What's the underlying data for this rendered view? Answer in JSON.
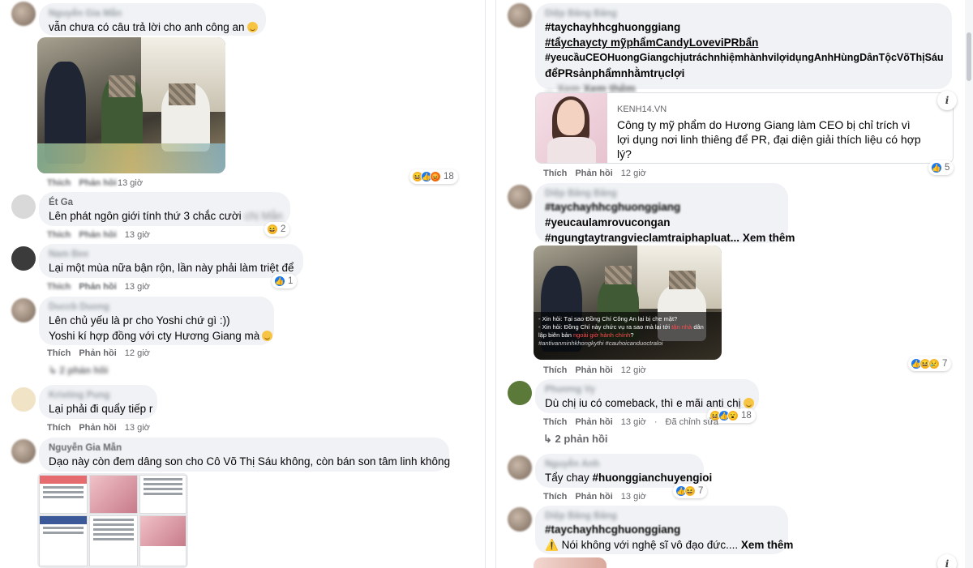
{
  "actions": {
    "like": "Thích",
    "reply": "Phản hồi",
    "edited": "Đã chỉnh sửa"
  },
  "left": {
    "c1": {
      "name": "Nguyễn Gia Mẫn",
      "text": "vẫn chưa có câu trả lời cho anh công an",
      "time": "13 giờ",
      "reactions": 18
    },
    "c2": {
      "name": "Ét Ga",
      "text_visible": "Lên phát ngôn giới tính thứ 3 chắc cười",
      "text_blurred": "chị Mẫn",
      "time": "13 giờ",
      "reactions": 2
    },
    "c3": {
      "name": "Nam Bee",
      "text": "Lại một mùa nữa bận rộn, lần này phải làm triệt để",
      "time": "13 giờ",
      "reactions": 1
    },
    "c4": {
      "name": "Duccb Duong",
      "line1": "Lên chủ yếu là pr cho Yoshi chứ gì :))",
      "line2": "Yoshi kí hợp đồng với cty Hương Giang mà",
      "time": "12 giờ",
      "replies": "2 phản hồi"
    },
    "c5": {
      "name": "Kristing Pung",
      "text": "Lại phải đi quẩy tiếp r",
      "time": "13 giờ"
    },
    "c6": {
      "name": "Nguyễn Gia Mẫn",
      "text": "Dạo này còn đem dâng son cho Cô Võ Thị Sáu không, còn bán son tâm linh không"
    }
  },
  "right": {
    "r1": {
      "name": "Diệp Băng Băng",
      "tag1": "#taychayhhcghuonggiang",
      "tag2": "#tẩychaycty mỹphẩmCandyLoveviPRbẩn",
      "tag3": "#yeucầuCEOHuongGiangchịutráchnhiệmhànhvilợidụngAnhHùngDânTộcVõThịSáu",
      "tag4": "đểPRsảnphẩmnhằmtrụclợi",
      "more": "Xem thêm",
      "link_source": "KENH14.VN",
      "link_title": "Công ty mỹ phẩm do Hương Giang làm CEO bị chỉ trích vì lợi dụng nơi linh thiêng để PR, đại diện giải thích liệu có hợp lý?",
      "time": "12 giờ",
      "reactions": 5
    },
    "r2": {
      "name": "Diệp Băng Băng",
      "tag1": "#taychayhhcghuonggiang",
      "tag2": "#yeucaulamrovucongan",
      "tag3": "#ngungtaytrangvieclamtraiphapluat...",
      "more": "Xem thêm",
      "caption1": "- Xin hỏi: Tại sao Đồng Chí Công An lại bị che mặt?",
      "caption2a": "- Xin hỏi: Đồng Chí này chức vụ ra sao mà lại tới",
      "caption2b": "tận nhà",
      "caption2c": "dân",
      "caption3a": "lập biên bản",
      "caption3b": "ngoài giờ hành chính",
      "caption3c": "?",
      "caption4": "#antivanminhkhongkythi   #cauhoicanduoctraloi",
      "time": "12 giờ",
      "reactions": 7
    },
    "r3": {
      "name": "Phương Vy",
      "text": "Dù chị iu có comeback, thì e mãi anti chị",
      "time": "13 giờ",
      "reactions": 18,
      "replies": "2 phản hồi"
    },
    "r4": {
      "name": "Nguyễn Anh",
      "text_prefix": "Tẩy chay",
      "text_tag": "#huonggianchuyengioi",
      "time": "13 giờ",
      "reactions": 7
    },
    "r5": {
      "name": "Diệp Băng Băng",
      "tag1": "#taychayhhcghuonggiang",
      "text": "Nói không với nghệ sĩ vô đạo đức....",
      "more": "Xem thêm"
    }
  },
  "colors": {
    "bubble": "#f0f2f5",
    "meta": "#65676b",
    "like": "#1877f2",
    "haha": "#f7b125",
    "angry": "#e9710f",
    "love": "#f33e58"
  }
}
